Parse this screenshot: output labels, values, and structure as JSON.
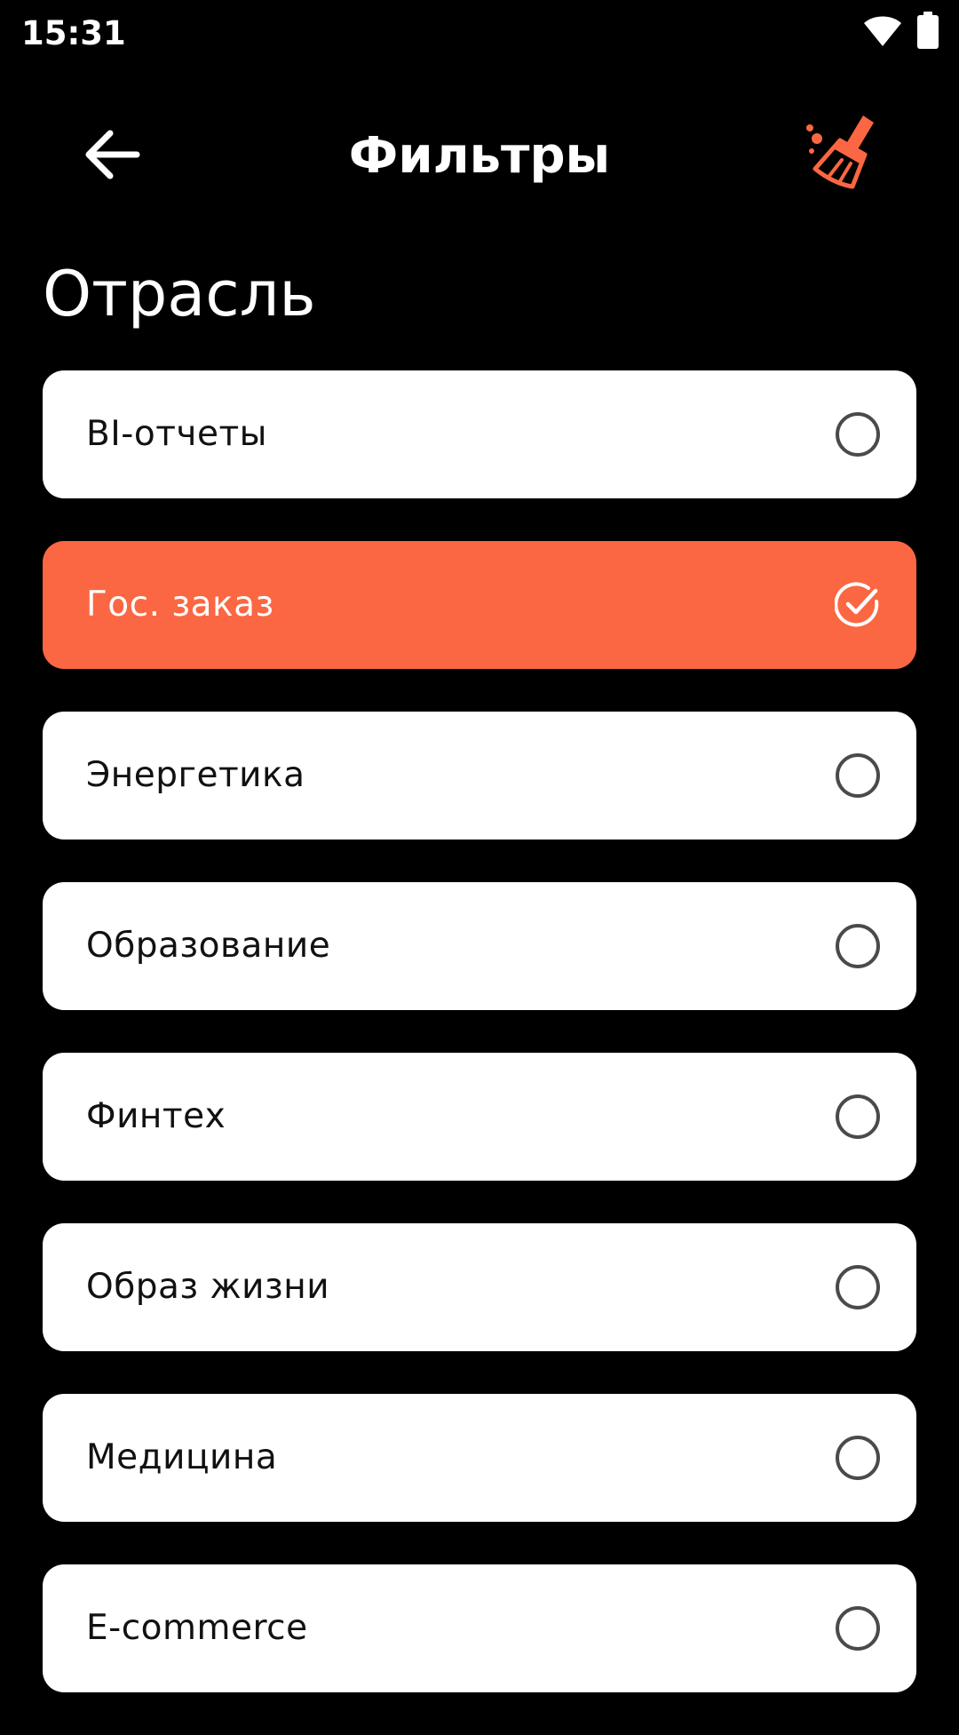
{
  "status_bar": {
    "time": "15:31",
    "icons": [
      "wifi-icon",
      "battery-icon"
    ]
  },
  "header": {
    "title": "Фильтры",
    "back_icon": "arrow-left-icon",
    "clear_icon": "broom-icon"
  },
  "section": {
    "title": "Отрасль"
  },
  "options": [
    {
      "label": "BI-отчеты",
      "selected": false
    },
    {
      "label": "Гос. заказ",
      "selected": true
    },
    {
      "label": "Энергетика",
      "selected": false
    },
    {
      "label": "Образование",
      "selected": false
    },
    {
      "label": "Финтех",
      "selected": false
    },
    {
      "label": "Образ жизни",
      "selected": false
    },
    {
      "label": "Медицина",
      "selected": false
    },
    {
      "label": "E-commerce",
      "selected": false
    }
  ],
  "colors": {
    "background": "#000000",
    "accent": "#fb6742",
    "card": "#ffffff",
    "text_dark": "#111111",
    "radio_stroke": "#4a4a4a"
  }
}
